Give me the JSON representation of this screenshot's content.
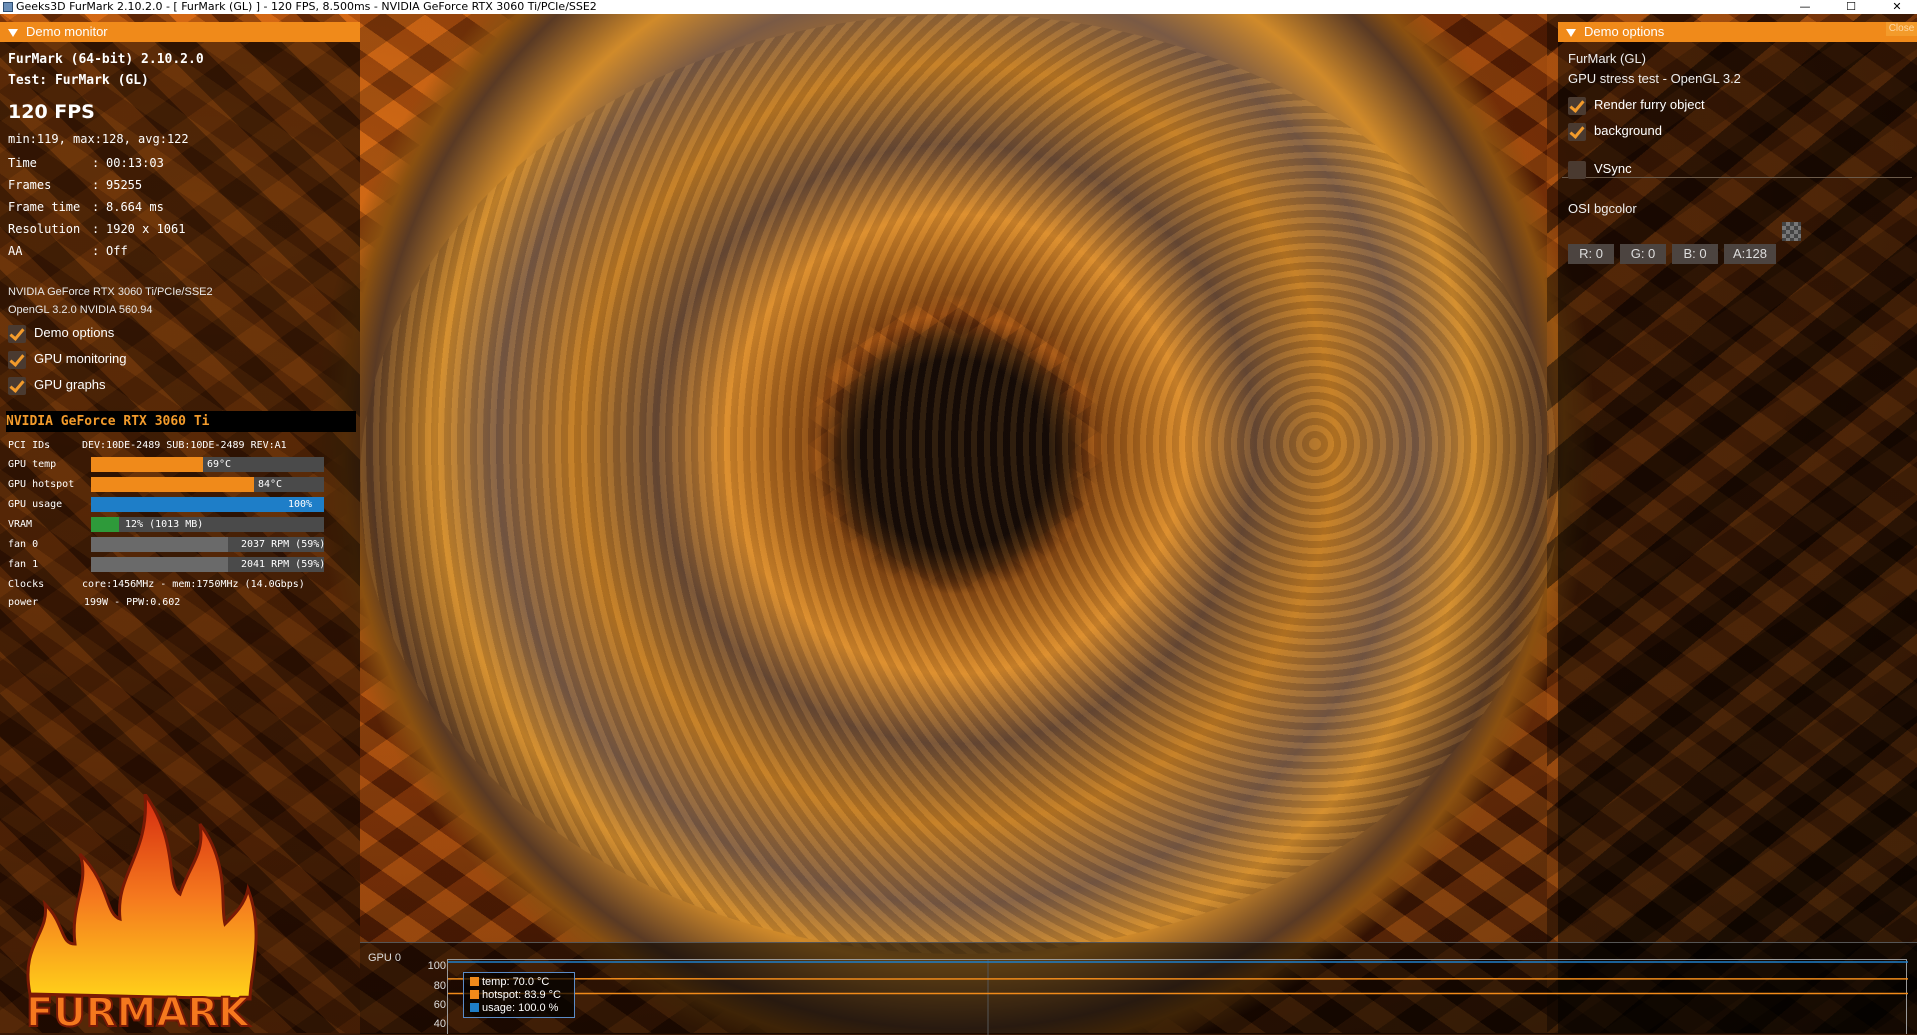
{
  "window": {
    "title": "Geeks3D FurMark 2.10.2.0 - [ FurMark (GL) ] - 120 FPS, 8.500ms - NVIDIA GeForce RTX 3060 Ti/PCIe/SSE2",
    "minimize_glyph": "—",
    "maximize_glyph": "☐",
    "close_glyph": "✕"
  },
  "demo_monitor": {
    "header": "Demo monitor",
    "version": "FurMark (64-bit) 2.10.2.0",
    "test": "Test: FurMark (GL)",
    "fps": "120 FPS",
    "fps_stats": "min:119, max:128, avg:122",
    "stats": [
      {
        "key": "Time",
        "value": "00:13:03"
      },
      {
        "key": "Frames",
        "value": "95255"
      },
      {
        "key": "Frame time",
        "value": "8.664 ms"
      },
      {
        "key": "Resolution",
        "value": "1920 x 1061"
      },
      {
        "key": "AA",
        "value": "Off"
      }
    ],
    "gpu_line": "NVIDIA GeForce RTX 3060 Ti/PCIe/SSE2",
    "gl_line": "OpenGL 3.2.0 NVIDIA 560.94",
    "checkboxes": [
      {
        "label": "Demo options",
        "checked": true
      },
      {
        "label": "GPU monitoring",
        "checked": true
      },
      {
        "label": "GPU graphs",
        "checked": true
      }
    ]
  },
  "gpu_monitor": {
    "header": "NVIDIA GeForce RTX 3060 Ti",
    "pci_label": "PCI IDs",
    "pci_value": "DEV:10DE-2489 SUB:10DE-2489 REV:A1",
    "rows": [
      {
        "label": "GPU temp",
        "text": "69°C",
        "fraction": 0.48,
        "color": "#f08a1a"
      },
      {
        "label": "GPU hotspot",
        "text": "84°C",
        "fraction": 0.7,
        "color": "#f08a1a"
      },
      {
        "label": "GPU usage",
        "text": "100%",
        "fraction": 1.0,
        "color": "#1e7ec8"
      },
      {
        "label": "VRAM",
        "text": "12% (1013 MB)",
        "fraction": 0.12,
        "color": "#2e9a3a"
      },
      {
        "label": "fan 0",
        "text": "2037 RPM (59%)",
        "fraction": 0.59,
        "color": "#6a6a6a"
      },
      {
        "label": "fan 1",
        "text": "2041 RPM (59%)",
        "fraction": 0.59,
        "color": "#6a6a6a"
      }
    ],
    "clocks_label": "Clocks",
    "clocks_value": "core:1456MHz - mem:1750MHz (14.0Gbps)",
    "power_label": "power",
    "power_value": "199W - PPW:0.602"
  },
  "logo": {
    "text": "FURMARK",
    "brand_color": "#f5781e"
  },
  "demo_options": {
    "header": "Demo options",
    "close_label": "Close",
    "demo_name": "FurMark (GL)",
    "demo_desc": "GPU stress test - OpenGL 3.2",
    "render_furry": "Render furry object",
    "background": "background",
    "vsync": "VSync",
    "osi_label": "OSI bgcolor",
    "r": "R: 0",
    "g": "G: 0",
    "b": "B: 0",
    "a": "A:128"
  },
  "graph": {
    "label": "GPU 0",
    "yticks": [
      "100",
      "80",
      "60",
      "40"
    ],
    "legend": [
      {
        "label": "temp: 70.0 °C",
        "color": "#f08a1a"
      },
      {
        "label": "hotspot: 83.9 °C",
        "color": "#f08a1a"
      },
      {
        "label": "usage: 100.0 %",
        "color": "#1e7ec8"
      }
    ],
    "chart_data": {
      "type": "line",
      "ylim": [
        40,
        100
      ],
      "series": [
        {
          "name": "temp",
          "values": [
            70,
            70,
            70,
            70,
            70,
            70,
            70,
            70
          ]
        },
        {
          "name": "hotspot",
          "values": [
            83.9,
            84,
            83.8,
            84,
            83.9,
            84,
            83.9,
            83.9
          ]
        },
        {
          "name": "usage",
          "values": [
            100,
            100,
            100,
            100,
            100,
            100,
            100,
            100
          ]
        }
      ]
    }
  }
}
